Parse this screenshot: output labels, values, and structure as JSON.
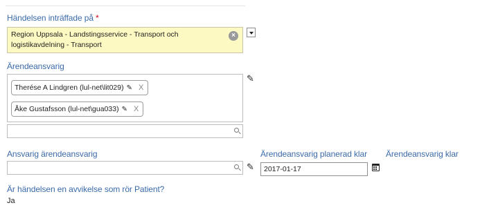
{
  "incident_location": {
    "label": "Händelsen inträffade på",
    "required_marker": "*",
    "value_line1": "Region Uppsala - Landstingsservice - Transport och",
    "value_line2": "logistikavdelning - Transport",
    "clear_icon": "clear-circle-x-icon",
    "dropdown_icon": "chevron-down-icon"
  },
  "case_responsible": {
    "label": "Ärendeansvarig",
    "chips": [
      {
        "name": "Therése A Lindgren (lul-net\\lit029)",
        "remove": "X"
      },
      {
        "name": "Åke Gustafsson (lul-net\\gua033)",
        "remove": "X"
      }
    ],
    "search_placeholder": ""
  },
  "responsible_owner": {
    "label": "Ansvarig ärendeansvarig",
    "search_placeholder": ""
  },
  "planned_done": {
    "label": "Ärendeansvarig planerad klar",
    "date": "2017-01-17"
  },
  "done": {
    "label": "Ärendeansvarig klar"
  },
  "patient_question": {
    "label": "Är händelsen en avvikelse som rör Patient?",
    "value": "Ja"
  }
}
